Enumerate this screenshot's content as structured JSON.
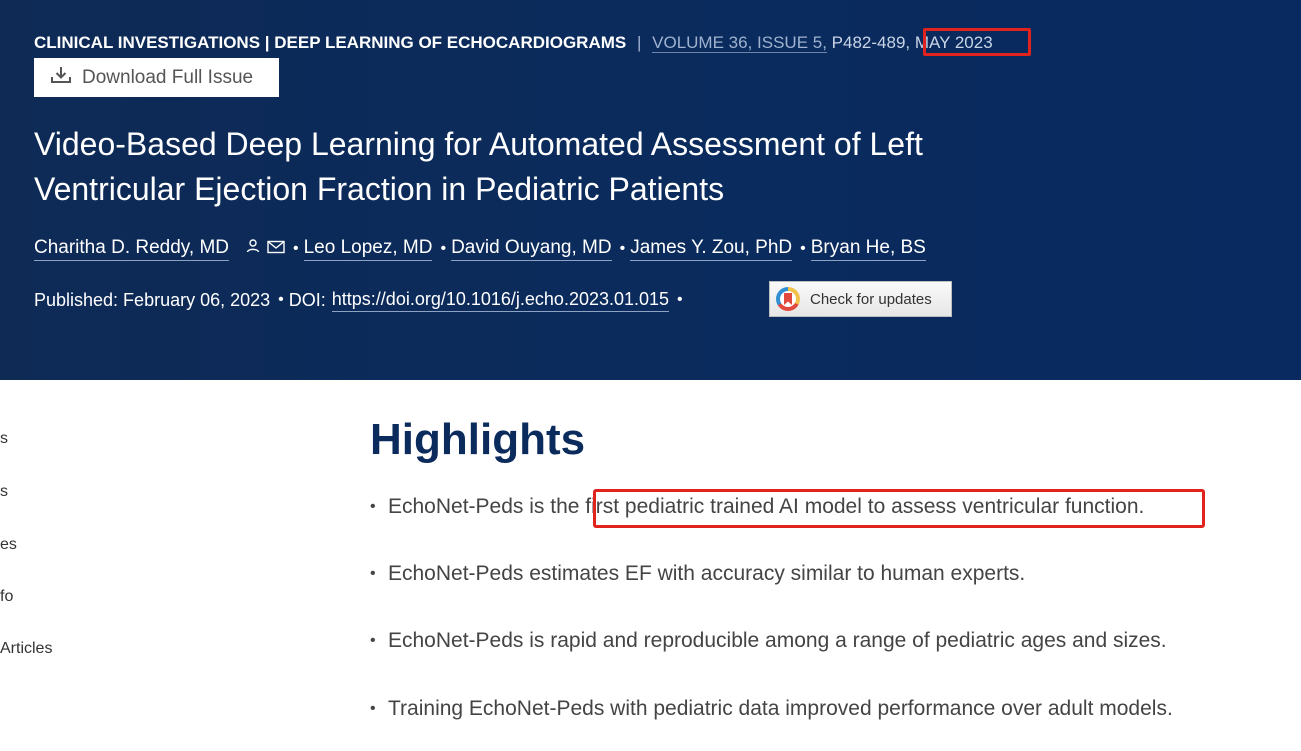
{
  "header": {
    "section": "CLINICAL INVESTIGATIONS | DEEP LEARNING OF ECHOCARDIOGRAMS",
    "separator": "|",
    "volume_issue": "VOLUME 36, ISSUE 5,",
    "pages": "P482-489,",
    "date": "MAY 2023",
    "download_label": "Download Full Issue",
    "title": "Video-Based Deep Learning for Automated Assessment of Left Ventricular Ejection Fraction in Pediatric Patients",
    "authors": [
      "Charitha D. Reddy, MD",
      "Leo Lopez, MD",
      "David Ouyang, MD",
      "James Y. Zou, PhD",
      "Bryan He, BS"
    ],
    "bullet": "•",
    "published_label": "Published: February 06, 2023",
    "doi_label": "DOI:",
    "doi_value": "https://doi.org/10.1016/j.echo.2023.01.015",
    "check_updates_label": "Check for updates"
  },
  "sidebar": {
    "items": [
      "s",
      "s",
      "es",
      "fo",
      "Articles"
    ]
  },
  "main": {
    "highlights_heading": "Highlights",
    "highlights": [
      {
        "lead": "EchoNet-Peds is the ",
        "emph": "first pediatric trained AI model to assess ventricular function."
      },
      {
        "lead": "EchoNet-Peds estimates EF with accuracy similar to human experts.",
        "emph": ""
      },
      {
        "lead": "EchoNet-Peds is rapid and reproducible among a range of pediatric ages and sizes.",
        "emph": ""
      },
      {
        "lead": "Training EchoNet-Peds with pediatric data improved performance over adult models.",
        "emph": ""
      }
    ]
  },
  "colors": {
    "hero_bg": "#0b2b5c",
    "heading": "#0b2b5c",
    "annotation_red": "#e0241d"
  },
  "icons": {
    "download": "download-icon",
    "person": "person-icon",
    "mail": "mail-icon",
    "crossmark": "crossmark-icon"
  }
}
